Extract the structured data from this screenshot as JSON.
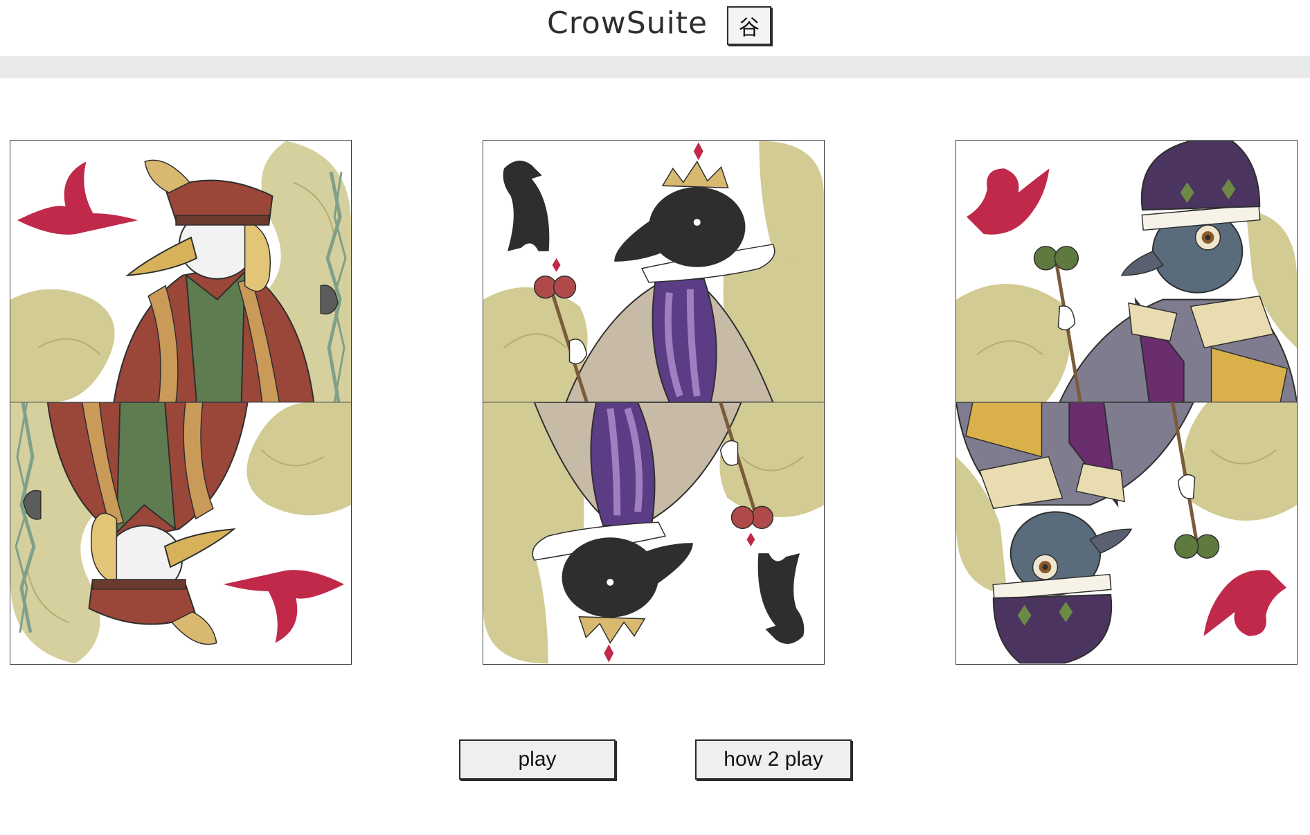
{
  "header": {
    "title": "CrowSuite",
    "lang_toggle_label": "谷"
  },
  "cards": [
    {
      "name": "king-card",
      "suit_icon": "red-bird-icon",
      "figure": "crow-king"
    },
    {
      "name": "queen-card",
      "suit_icon": "black-crow-icon",
      "figure": "crow-queen"
    },
    {
      "name": "jack-card",
      "suit_icon": "red-dove-icon",
      "figure": "pigeon-bishop"
    }
  ],
  "actions": {
    "play_label": "play",
    "how_to_play_label": "how 2 play"
  },
  "colors": {
    "accent_red": "#c0294a",
    "leaf_olive": "#d2cb94",
    "ink": "#2e2e2e",
    "header_bar": "#e9eaec"
  }
}
